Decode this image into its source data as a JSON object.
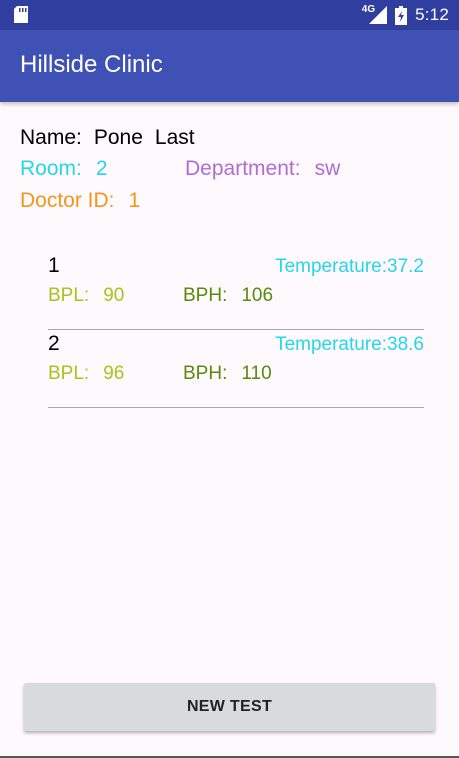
{
  "status_bar": {
    "network": "4G",
    "time": "5:12",
    "icons": [
      "sd-card-icon",
      "signal-icon",
      "battery-icon"
    ]
  },
  "app_bar": {
    "title": "Hillside Clinic"
  },
  "patient": {
    "name_label": "Name:",
    "first_name": "Pone",
    "last_name": "Last",
    "room_label": "Room:",
    "room": "2",
    "department_label": "Department:",
    "department": "sw",
    "doctor_label": "Doctor ID:",
    "doctor_id": "1"
  },
  "tests": [
    {
      "index": "1",
      "temperature": "Temperature:37.2",
      "bpl_label": "BPL:",
      "bpl": "90",
      "bph_label": "BPH:",
      "bph": "106"
    },
    {
      "index": "2",
      "temperature": "Temperature:38.6",
      "bpl_label": "BPL:",
      "bpl": "96",
      "bph_label": "BPH:",
      "bph": "110"
    }
  ],
  "actions": {
    "new_test_label": "NEW TEST"
  },
  "colors": {
    "status_bar": "#303f9f",
    "app_bar": "#3f51b5",
    "room": "#26d6ea",
    "department": "#b36bd4",
    "doctor": "#f7941d",
    "bpl": "#a5c41c",
    "bph": "#5b8a0a"
  }
}
